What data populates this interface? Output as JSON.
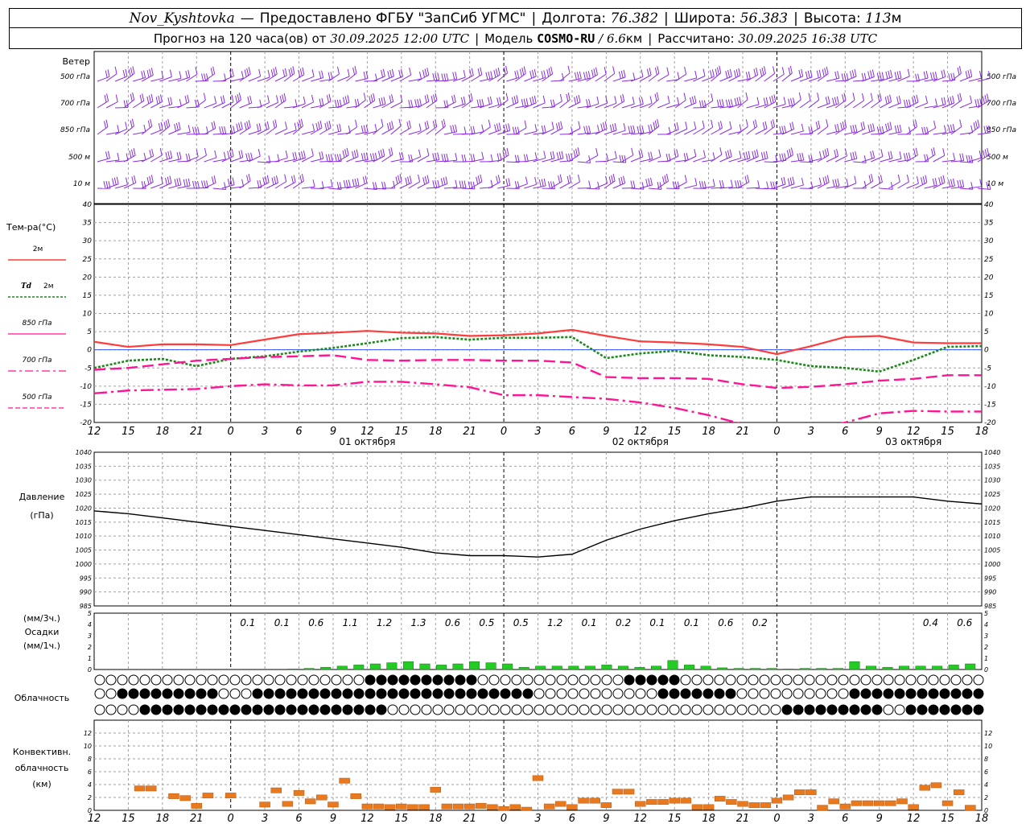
{
  "header": {
    "station": "Nov_Kyshtovka",
    "dash": "—",
    "provider": "Предоставлено ФГБУ \"ЗапСиб УГМС\"",
    "lon_label": "Долгота:",
    "lon_value": "76.382",
    "lat_label": "Широта:",
    "lat_value": "56.383",
    "alt_label": "Высота:",
    "alt_value": "113",
    "alt_unit": "м",
    "forecast_label": "Прогноз на 120 часа(ов) от",
    "forecast_start": "30.09.2025 12:00 UTC",
    "model_label": "Модель",
    "model_name": "COSMO-RU",
    "model_sep": "/",
    "model_res": "6.6",
    "model_res_unit": "км",
    "calc_label": "Рассчитано:",
    "calc_time": "30.09.2025 16:38 UTC"
  },
  "colors": {
    "t2m": "#ff3b3b",
    "td2m": "#1a8a1a",
    "pink": "#ff1493",
    "wind": "#8a2be2",
    "precip": "#22cc22",
    "precip_snow": "#2255cc",
    "convective": "#e8791e",
    "grid": "#a0a0a0"
  },
  "chart_data": [
    {
      "type": "barbs",
      "panel": "wind",
      "title": "Ветер",
      "levels": [
        "500 гПа",
        "700 гПа",
        "850 гПа",
        "500 м",
        "10  м"
      ]
    },
    {
      "type": "line",
      "panel": "temperature",
      "title": "Тем-ра(°C)",
      "ylim": [
        -20,
        40
      ],
      "yticks": [
        -20,
        -15,
        -10,
        -5,
        0,
        5,
        10,
        15,
        20,
        25,
        30,
        35,
        40
      ],
      "x_hours": [
        0,
        3,
        6,
        9,
        12,
        15,
        18,
        21,
        24,
        27,
        30,
        33,
        36,
        39,
        42,
        45,
        48,
        51,
        54,
        57,
        60,
        63,
        66,
        69,
        72,
        75,
        78
      ],
      "series": [
        {
          "name": "2м",
          "symbol": "",
          "style": "solid",
          "color": "#ff3b3b",
          "values": [
            2.2,
            0.8,
            1.5,
            1.5,
            1.3,
            2.8,
            4.3,
            4.7,
            5.2,
            4.7,
            4.5,
            3.8,
            4.0,
            4.5,
            5.5,
            3.8,
            2.3,
            2.0,
            1.5,
            0.8,
            -1.2,
            1.0,
            3.5,
            3.8,
            2.0,
            1.8,
            1.8
          ]
        },
        {
          "name": "2м",
          "symbol": "Td",
          "style": "dotted",
          "color": "#1a8a1a",
          "values": [
            -5.0,
            -3.0,
            -2.5,
            -4.5,
            -2.5,
            -1.8,
            -0.5,
            0.5,
            1.8,
            3.2,
            3.5,
            2.8,
            3.3,
            3.3,
            3.5,
            -2.3,
            -1.0,
            -0.3,
            -1.5,
            -2.0,
            -2.8,
            -4.5,
            -5.0,
            -6.0,
            -2.8,
            0.8,
            1.0
          ]
        },
        {
          "name": "850 гПа",
          "symbol": "",
          "style": "dashed",
          "color": "#ff1493",
          "values": [
            -5.5,
            -5.0,
            -4.0,
            -3.0,
            -2.5,
            -2.0,
            -1.8,
            -1.5,
            -2.8,
            -3.0,
            -2.8,
            -2.8,
            -3.0,
            -3.0,
            -3.5,
            -7.5,
            -7.8,
            -7.8,
            -8.0,
            -9.5,
            -10.5,
            -10.2,
            -9.5,
            -8.5,
            -8.0,
            -7.0,
            -7.0
          ]
        },
        {
          "name": "700 гПа",
          "symbol": "",
          "style": "dashdot",
          "color": "#ff1493",
          "values": [
            -12.0,
            -11.2,
            -11.0,
            -10.8,
            -10.0,
            -9.5,
            -9.8,
            -9.8,
            -8.8,
            -8.8,
            -9.5,
            -10.3,
            -12.5,
            -12.5,
            -13.0,
            -13.5,
            -14.5,
            -16.0,
            -18.0,
            -20.5,
            -22.0,
            -22.0,
            -20.0,
            -17.5,
            -16.8,
            -17.0,
            -17.0
          ]
        }
      ],
      "legend_extra": {
        "name": "500 гПа",
        "style": "dashed-thin"
      }
    },
    {
      "type": "line",
      "panel": "pressure",
      "title": "Давление",
      "unit": "(гПа)",
      "ylim": [
        985,
        1040
      ],
      "yticks": [
        985,
        990,
        995,
        1000,
        1005,
        1010,
        1015,
        1020,
        1025,
        1030,
        1035,
        1040
      ],
      "x_hours": [
        0,
        3,
        6,
        9,
        12,
        15,
        18,
        21,
        24,
        27,
        30,
        33,
        36,
        39,
        42,
        45,
        48,
        51,
        54,
        57,
        60,
        63,
        66,
        69,
        72,
        75,
        78
      ],
      "values": [
        1019,
        1018,
        1016.5,
        1015,
        1013.5,
        1012,
        1010.5,
        1009,
        1007.5,
        1006,
        1004,
        1003,
        1003,
        1002.5,
        1003.5,
        1008.5,
        1012.5,
        1015.5,
        1018,
        1020,
        1022.5,
        1024,
        1024,
        1024,
        1024,
        1022.5,
        1021.5
      ]
    },
    {
      "type": "bar",
      "panel": "precipitation",
      "title": "Осадки",
      "unit_3h": "(мм/3ч.)",
      "unit_1h": "(мм/1ч.)",
      "ylim": [
        0,
        5
      ],
      "yticks": [
        0,
        1,
        2,
        3,
        4,
        5
      ],
      "x_hours": [
        15,
        18,
        21,
        24,
        27,
        30,
        33,
        36,
        39,
        42,
        45,
        48,
        51,
        54,
        57,
        60,
        63,
        66,
        69,
        72,
        75,
        78
      ],
      "totals_3h": [
        "0.1",
        "0.1",
        "0.6",
        "1.1",
        "1.2",
        "1.3",
        "0.6",
        "0.5",
        "0.5",
        "1.2",
        "0.1",
        "0.2",
        "0.1",
        "0.1",
        "0.6",
        "0.2",
        "",
        "",
        "",
        "",
        "0.4",
        "0.6"
      ],
      "hourly_mm": [
        0.05,
        0.1,
        0.2,
        0.3,
        0.4,
        0.5,
        0.6,
        0.7,
        0.5,
        0.4,
        0.5,
        0.7,
        0.6,
        0.5,
        0.2,
        0.3,
        0.3,
        0.3,
        0.3,
        0.4,
        0.3,
        0.2,
        0.3,
        0.8,
        0.4,
        0.3,
        0.15,
        0.1,
        0.1,
        0.1,
        0.05,
        0.1,
        0.1,
        0.1,
        0.7,
        0.3,
        0.2,
        0.3,
        0.3,
        0.3,
        0.4,
        0.5
      ]
    },
    {
      "type": "symbols",
      "panel": "clouds",
      "title": "Облачность"
    },
    {
      "type": "bar",
      "panel": "convective",
      "title": "Конвективн. облачность",
      "unit": "(км)",
      "ylim": [
        0,
        14
      ],
      "yticks": [
        0,
        2,
        4,
        6,
        8,
        10,
        12
      ],
      "x_hours": [
        4,
        5,
        7,
        8,
        9,
        10,
        12,
        13,
        15,
        16,
        17,
        18,
        19,
        20,
        21,
        22,
        23,
        24,
        25,
        26,
        27,
        28,
        29,
        30,
        31,
        32,
        33,
        34,
        35,
        36,
        37,
        38,
        39,
        40,
        41,
        42,
        43,
        44,
        45,
        46,
        47,
        48,
        49,
        50,
        51,
        52,
        53,
        54,
        55,
        56,
        57,
        58,
        59,
        60,
        61,
        62,
        63,
        64,
        65,
        66,
        67,
        68,
        69,
        70,
        71,
        72,
        73,
        74,
        75,
        76,
        77
      ],
      "values": [
        3.8,
        3.8,
        2.6,
        2.3,
        1.1,
        2.7,
        2.7,
        0,
        1.3,
        3.5,
        1.4,
        3.1,
        1.8,
        2.4,
        1.3,
        5.0,
        2.6,
        1.0,
        1.0,
        0.9,
        1.0,
        0.9,
        0.9,
        3.6,
        1.0,
        1.0,
        1.0,
        1.1,
        0.9,
        0.6,
        0.9,
        0.5,
        5.4,
        1.0,
        1.4,
        0.9,
        1.9,
        1.9,
        1.2,
        3.3,
        3.3,
        1.4,
        1.7,
        1.7,
        1.9,
        1.9,
        0.9,
        0.9,
        2.2,
        1.7,
        1.4,
        1.2,
        1.2,
        1.9,
        2.4,
        3.2,
        3.2,
        0.8,
        1.8,
        1.0,
        1.5,
        1.5,
        1.5,
        1.5,
        1.8,
        0.9,
        3.9,
        4.3,
        1.5,
        3.2,
        0.8
      ]
    }
  ],
  "axis": {
    "hour_ticks": [
      "12",
      "15",
      "18",
      "21",
      "0",
      "3",
      "6",
      "9",
      "12",
      "15",
      "18",
      "21",
      "0",
      "3",
      "6",
      "9",
      "12",
      "15",
      "18",
      "21",
      "0",
      "3",
      "6",
      "9",
      "12",
      "15",
      "18"
    ],
    "day_labels": [
      "01 октября",
      "02 октября",
      "03 октября"
    ]
  }
}
